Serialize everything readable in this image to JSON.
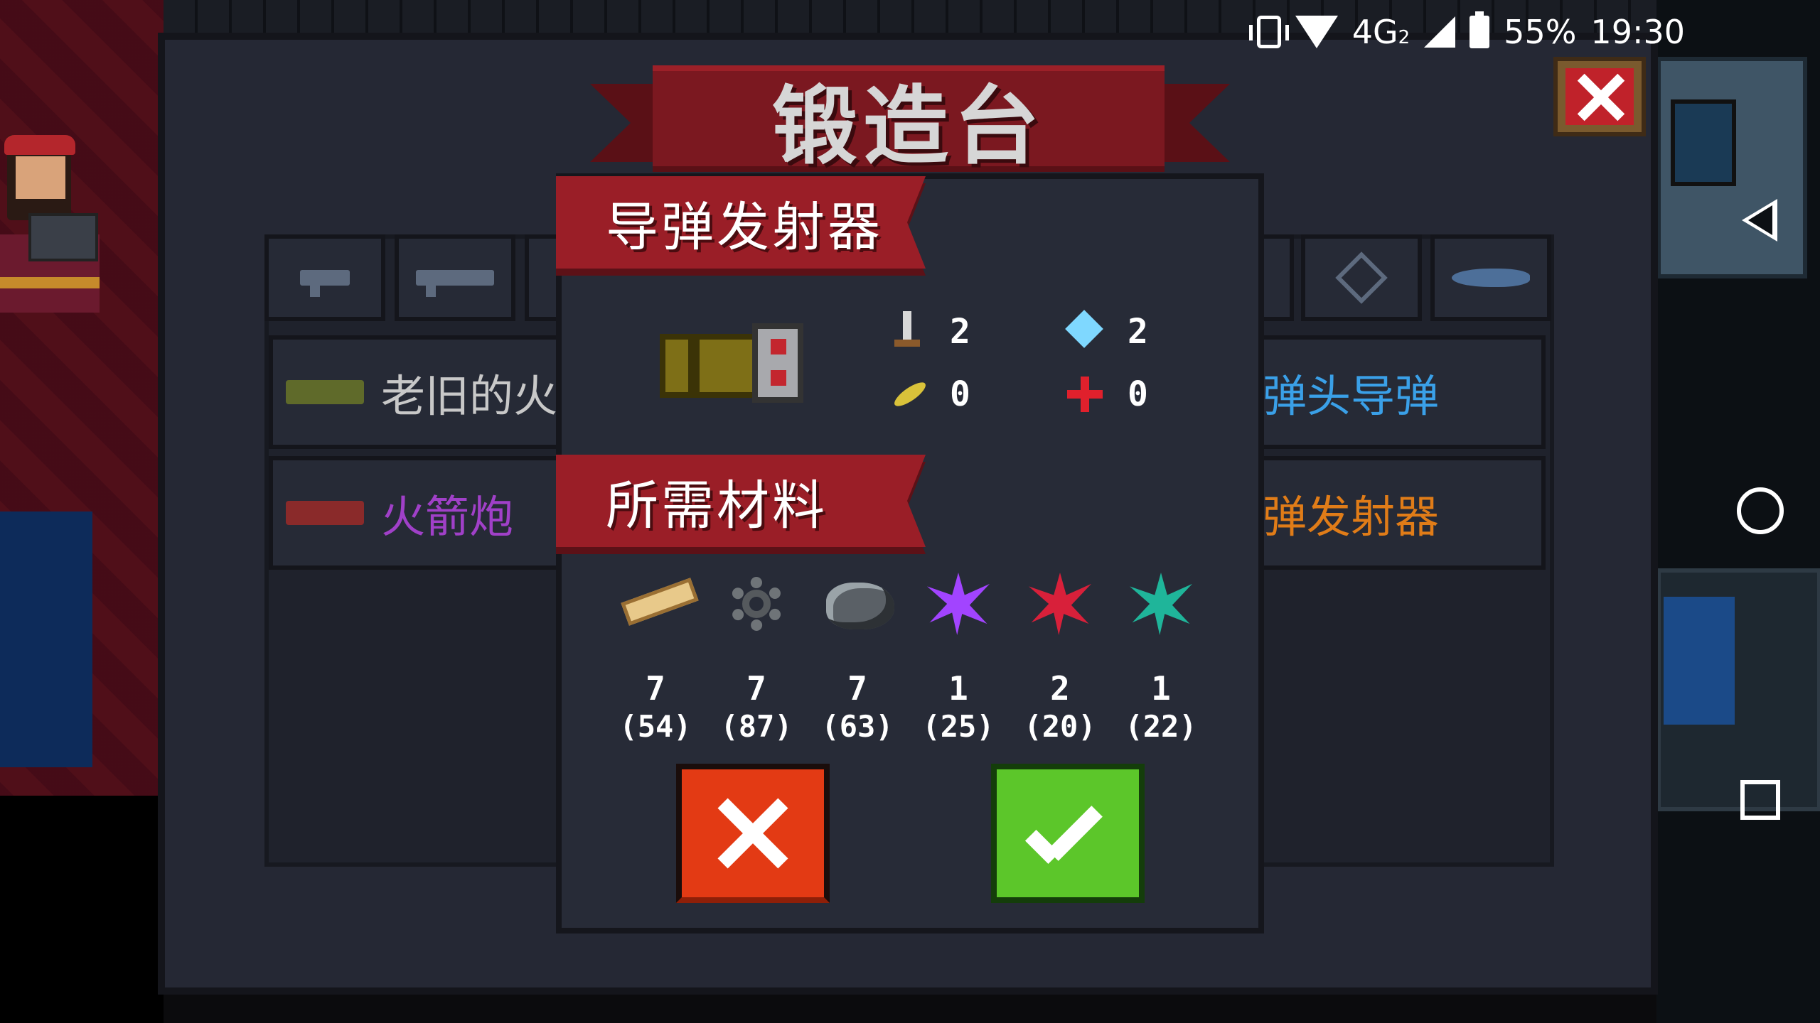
{
  "status_bar": {
    "network": "4G",
    "network_sub": "2",
    "battery": "55%",
    "time": "19:30"
  },
  "forge": {
    "title": "锻造台",
    "close_icon": "close-icon",
    "tabs": [
      {
        "icon": "pistol-icon"
      },
      {
        "icon": "rifle-icon"
      },
      {
        "icon": "launcher-icon"
      },
      {
        "icon": "blaster-icon"
      },
      {
        "icon": "target-icon"
      },
      {
        "icon": "fish-icon"
      }
    ],
    "rows": [
      {
        "label": "老旧的火",
        "color": "#c8c8c8",
        "icon_color": "#5f6a2a"
      },
      {
        "label": "弹头导弹",
        "color": "#3aa0e8",
        "side": "right"
      },
      {
        "label": "火箭炮",
        "color": "#a040c8",
        "icon_color": "#8a2a2a"
      },
      {
        "label": "弹发射器",
        "color": "#e07c18",
        "side": "right"
      }
    ]
  },
  "popup": {
    "weapon_name": "导弹发射器",
    "materials_header": "所需材料",
    "stats": {
      "damage": "2",
      "energy": "2",
      "crit": "0",
      "accuracy": "0"
    },
    "materials": [
      {
        "icon": "wood-icon",
        "required": "7",
        "have": "(54)"
      },
      {
        "icon": "gear-icon",
        "required": "7",
        "have": "(87)"
      },
      {
        "icon": "ore-icon",
        "required": "7",
        "have": "(63)"
      },
      {
        "icon": "purple-crystal-icon",
        "required": "1",
        "have": "(25)"
      },
      {
        "icon": "red-crystal-icon",
        "required": "2",
        "have": "(20)"
      },
      {
        "icon": "green-crystal-icon",
        "required": "1",
        "have": "(22)"
      }
    ],
    "colors": {
      "cancel": "#e33a14",
      "confirm": "#5cc62a",
      "ribbon": "#9a1e27"
    }
  }
}
